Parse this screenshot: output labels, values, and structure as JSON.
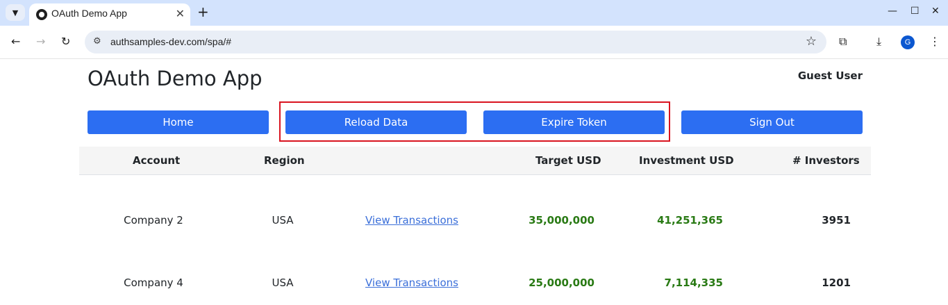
{
  "browser": {
    "tab_title": "OAuth Demo App",
    "url": "authsamples-dev.com/spa/#",
    "avatar_letter": "G"
  },
  "app": {
    "title": "OAuth Demo App",
    "user": "Guest User"
  },
  "buttons": {
    "home": "Home",
    "reload": "Reload Data",
    "expire": "Expire Token",
    "signout": "Sign Out"
  },
  "table": {
    "headers": {
      "account": "Account",
      "region": "Region",
      "target": "Target USD",
      "investment": "Investment USD",
      "investors": "# Investors"
    },
    "rows": [
      {
        "account": "Company 2",
        "region": "USA",
        "link": "View Transactions",
        "target": "35,000,000",
        "investment": "41,251,365",
        "investors": "3951"
      },
      {
        "account": "Company 4",
        "region": "USA",
        "link": "View Transactions",
        "target": "25,000,000",
        "investment": "7,114,335",
        "investors": "1201"
      }
    ]
  },
  "colors": {
    "button": "#2c6ef2",
    "highlight": "#d9141f",
    "amount_green": "#297a14",
    "link": "#3b6fd9"
  }
}
